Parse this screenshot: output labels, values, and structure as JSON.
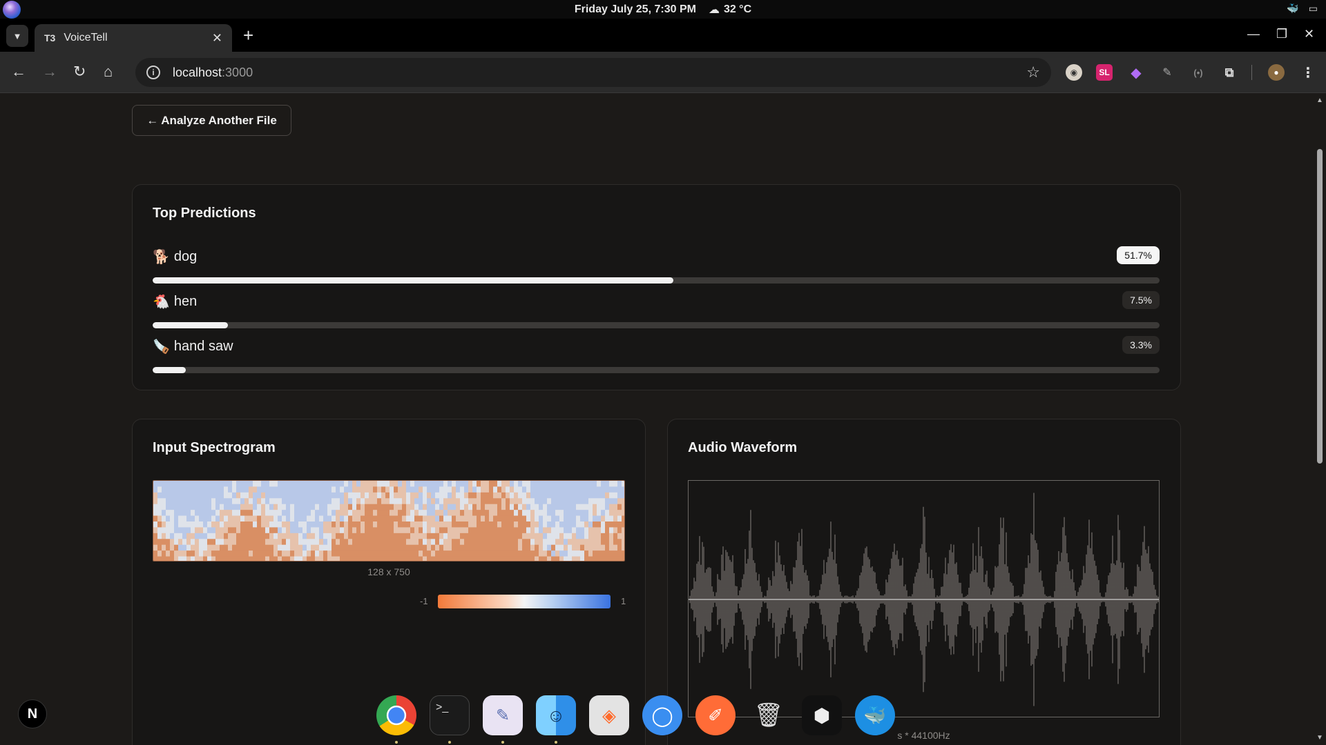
{
  "os": {
    "clock": "Friday July 25, 7:30 PM",
    "weather": "32 °C"
  },
  "browser": {
    "tab_title": "VoiceTell",
    "tab_favicon": "T3",
    "url_host": "localhost",
    "url_port": ":3000",
    "extensions": [
      "reader-icon",
      "SL",
      "gem-icon",
      "grammar-icon",
      "broadcast-icon",
      "puzzle-icon"
    ]
  },
  "page": {
    "back_button": "← Analyze Another File",
    "predictions_card": {
      "title": "Top Predictions",
      "items": [
        {
          "emoji": "🐕",
          "label": "dog",
          "percent": "51.7%",
          "value": 0.517
        },
        {
          "emoji": "🐔",
          "label": "hen",
          "percent": "7.5%",
          "value": 0.075
        },
        {
          "emoji": "🪚",
          "label": "hand saw",
          "percent": "3.3%",
          "value": 0.033
        }
      ]
    },
    "spectrogram_card": {
      "title": "Input Spectrogram",
      "caption": "128 x 750",
      "colorbar_min": "-1",
      "colorbar_max": "1"
    },
    "waveform_card": {
      "title": "Audio Waveform",
      "caption": "s * 44100Hz"
    }
  },
  "dock": {
    "apps": [
      "chrome",
      "terminal",
      "text-editor",
      "finder",
      "browser",
      "signal",
      "postman",
      "trash",
      "box",
      "docker"
    ]
  },
  "nextjs_badge": "N",
  "colors": {
    "page_bg": "#1c1a18",
    "card_bg": "#171615",
    "bar_fill": "#f1f1f1",
    "bar_track": "#3c3a38"
  }
}
